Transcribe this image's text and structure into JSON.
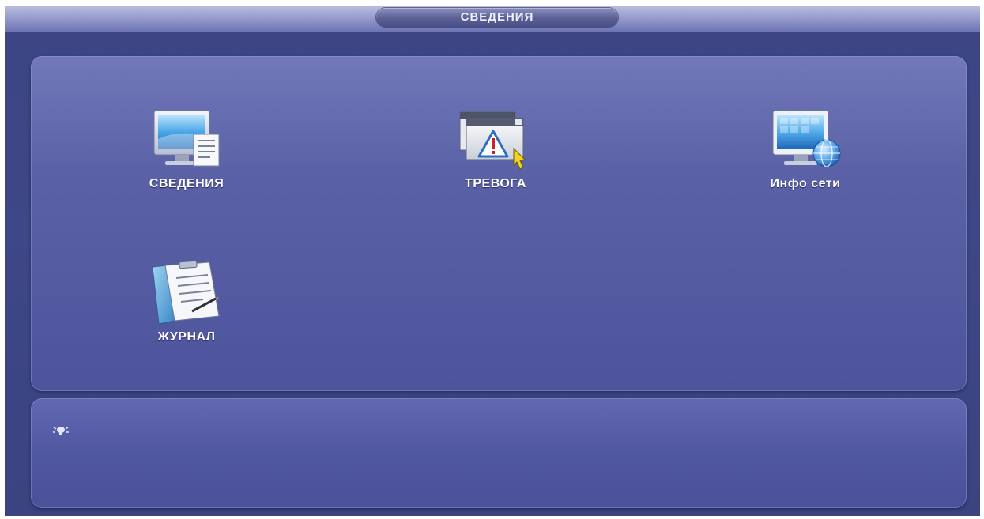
{
  "header": {
    "title": "СВЕДЕНИЯ"
  },
  "tiles": [
    {
      "label": "СВЕДЕНИЯ",
      "icon": "monitor-document-icon"
    },
    {
      "label": "ТРЕВОГА",
      "icon": "alarm-warning-icon"
    },
    {
      "label": "Инфо сети",
      "icon": "network-globe-icon"
    },
    {
      "label": "ЖУРНАЛ",
      "icon": "log-clipboard-icon"
    }
  ],
  "info_panel": {
    "icon": "tip-lightbulb-icon"
  },
  "colors": {
    "background": "#3e4787",
    "panel": "#5a61a6",
    "title_bar": "#8f95c8",
    "text": "#ffffff"
  }
}
